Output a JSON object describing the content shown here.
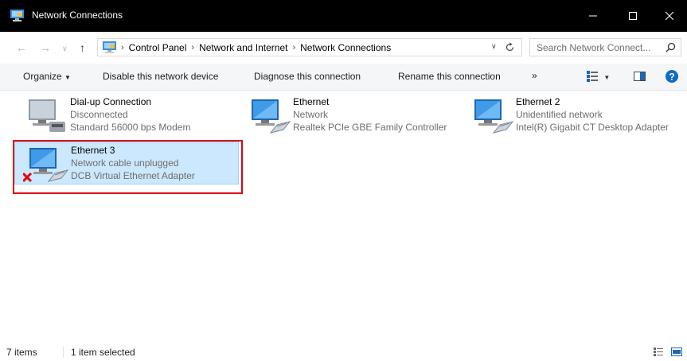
{
  "window": {
    "title": "Network Connections"
  },
  "address": {
    "crumbs": [
      "Control Panel",
      "Network and Internet",
      "Network Connections"
    ]
  },
  "search": {
    "placeholder": "Search Network Connect..."
  },
  "commands": {
    "organize": "Organize",
    "disable": "Disable this network device",
    "diagnose": "Diagnose this connection",
    "rename": "Rename this connection",
    "more": "»"
  },
  "items": [
    {
      "name": "Dial-up Connection",
      "status": "Disconnected",
      "device": "Standard 56000 bps Modem",
      "icon": "modem-icon"
    },
    {
      "name": "Ethernet",
      "status": "Network",
      "device": "Realtek PCIe GBE Family Controller",
      "icon": "network-icon"
    },
    {
      "name": "Ethernet 2",
      "status": "Unidentified network",
      "device": "Intel(R) Gigabit CT Desktop Adapter",
      "icon": "network-icon"
    },
    {
      "name": "Ethernet 3",
      "status": "Network cable unplugged",
      "device": "DCB Virtual Ethernet Adapter",
      "icon": "network-unplugged-icon",
      "selected": true
    }
  ],
  "status": {
    "count": "7 items",
    "selection": "1 item selected"
  },
  "colors": {
    "titlebar": "#000000",
    "selection": "#cce8ff",
    "highlight": "#e1000f",
    "help": "#0f6ac6"
  }
}
